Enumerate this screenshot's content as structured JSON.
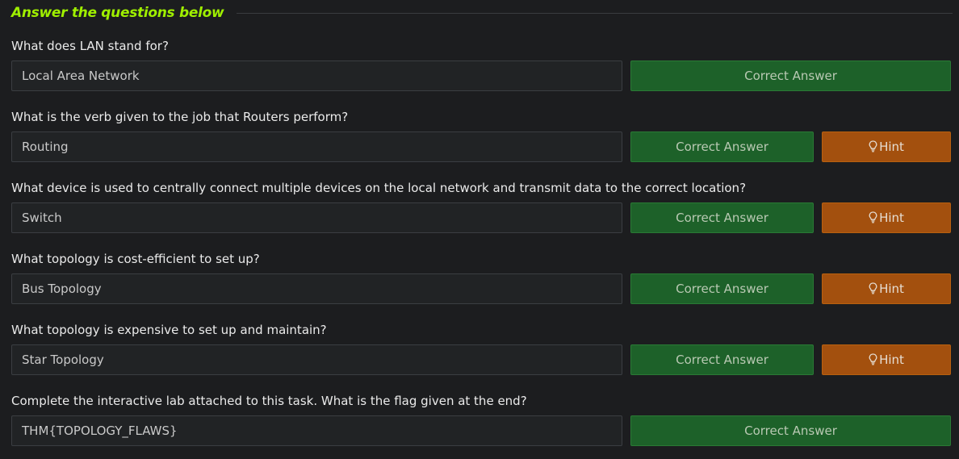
{
  "header": {
    "title": "Answer the questions below"
  },
  "questions": [
    {
      "question": "What does LAN stand for?",
      "answer": "Local Area Network",
      "button": "Correct Answer"
    },
    {
      "question": "What is the verb given to the job that Routers perform?",
      "answer": "Routing",
      "button": "Correct Answer",
      "hint": "Hint"
    },
    {
      "question": "What device is used to centrally connect multiple devices on the local network and transmit data to the correct location?",
      "answer": "Switch",
      "button": "Correct Answer",
      "hint": "Hint"
    },
    {
      "question": "What topology is cost-efficient to set up?",
      "answer": "Bus Topology",
      "button": "Correct Answer",
      "hint": "Hint"
    },
    {
      "question": "What topology is expensive to set up and maintain?",
      "answer": "Star Topology",
      "button": "Correct Answer",
      "hint": "Hint"
    },
    {
      "question": "Complete the interactive lab attached to this task. What is the flag given at the end?",
      "answer": "THM{TOPOLOGY_FLAWS}",
      "button": "Correct Answer"
    }
  ],
  "icons": {
    "hint": "lightbulb-icon"
  },
  "colors": {
    "accent": "#9fef00",
    "correct": "#1d6129",
    "hint": "#a3500e"
  }
}
